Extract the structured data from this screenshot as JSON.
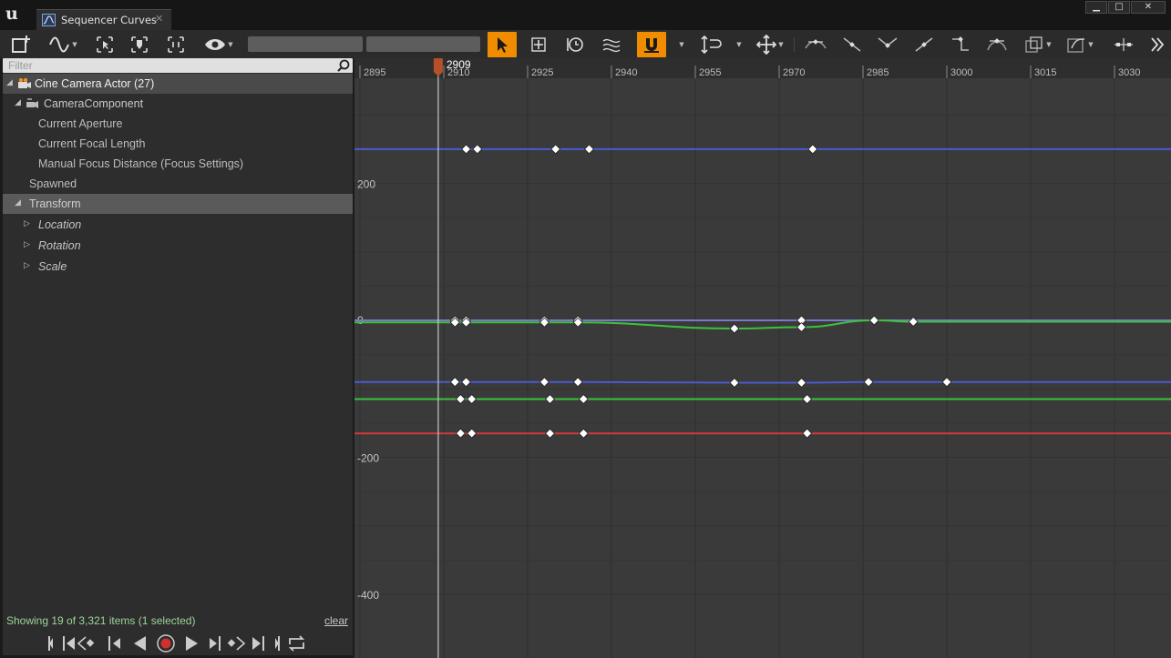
{
  "window": {
    "tab_title": "Sequencer Curves",
    "tab_close": "✕",
    "minimize": "▁",
    "maximize": "□",
    "close": "✕"
  },
  "filter": {
    "placeholder": "Filter"
  },
  "tree": [
    {
      "id": "cine-camera-actor",
      "label": "Cine Camera Actor (27)",
      "expander": "◢",
      "icon": "camera-actor-icon",
      "style": "selected"
    },
    {
      "id": "camera-component",
      "label": "CameraComponent",
      "expander": "◢",
      "icon": "camera-component-icon",
      "style": "normal"
    },
    {
      "id": "current-aperture",
      "label": "Current Aperture",
      "style": "normal"
    },
    {
      "id": "current-focal-length",
      "label": "Current Focal Length",
      "style": "normal"
    },
    {
      "id": "manual-focus-distance",
      "label": "Manual Focus Distance (Focus Settings)",
      "style": "normal"
    },
    {
      "id": "spawned",
      "label": "Spawned",
      "style": "normal"
    },
    {
      "id": "transform",
      "label": "Transform",
      "expander": "◢",
      "style": "gray"
    },
    {
      "id": "location",
      "label": "Location",
      "expander": "▷",
      "style": "italic"
    },
    {
      "id": "rotation",
      "label": "Rotation",
      "expander": "▷",
      "style": "italic"
    },
    {
      "id": "scale",
      "label": "Scale",
      "expander": "▷",
      "style": "italic"
    }
  ],
  "status": {
    "text": "Showing 19 of 3,321 items (1 selected)",
    "clear": "clear"
  },
  "timeline": {
    "current_frame": "2909",
    "ticks": [
      "2895",
      "2910",
      "2925",
      "2940",
      "2955",
      "2970",
      "2985",
      "3000",
      "3015",
      "3030"
    ]
  },
  "value_axis": {
    "labels": [
      "200",
      "0",
      "-200",
      "-400"
    ]
  },
  "colors": {
    "accent_orange": "#f08c00",
    "curve_blue": "#4a5ad2",
    "curve_green": "#3dc23d",
    "curve_red": "#d23a3a",
    "playhead": "#b5502a",
    "status_green": "#9ad59a"
  },
  "chart_data": {
    "type": "line",
    "xlabel": "",
    "ylabel": "",
    "xlim": [
      2890,
      3040
    ],
    "series": [
      {
        "color": "#4a5ad2",
        "keys": [
          [
            2914,
            250
          ],
          [
            2916,
            250
          ],
          [
            2930,
            250
          ],
          [
            2936,
            250
          ],
          [
            2976,
            250
          ]
        ]
      },
      {
        "color": "#7a78c8",
        "keys": [
          [
            2912,
            0
          ],
          [
            2914,
            0
          ],
          [
            2928,
            0
          ],
          [
            2934,
            0
          ],
          [
            2974,
            0
          ]
        ]
      },
      {
        "color": "#3dc23d",
        "keys": [
          [
            2912,
            -3
          ],
          [
            2914,
            -3
          ],
          [
            2928,
            -3
          ],
          [
            2934,
            -3
          ],
          [
            2962,
            -12
          ],
          [
            2974,
            -10
          ],
          [
            2987,
            0
          ],
          [
            2994,
            -2
          ]
        ]
      },
      {
        "color": "#4a5ad2",
        "keys": [
          [
            2912,
            -90
          ],
          [
            2914,
            -90
          ],
          [
            2928,
            -90
          ],
          [
            2934,
            -90
          ],
          [
            2962,
            -91
          ],
          [
            2974,
            -91
          ],
          [
            2986,
            -90
          ],
          [
            3000,
            -90
          ]
        ]
      },
      {
        "color": "#3dc23d",
        "keys": [
          [
            2913,
            -115
          ],
          [
            2915,
            -115
          ],
          [
            2929,
            -115
          ],
          [
            2935,
            -115
          ],
          [
            2975,
            -115
          ]
        ]
      },
      {
        "color": "#d23a3a",
        "keys": [
          [
            2913,
            -165
          ],
          [
            2915,
            -165
          ],
          [
            2929,
            -165
          ],
          [
            2935,
            -165
          ],
          [
            2975,
            -165
          ]
        ]
      }
    ]
  }
}
